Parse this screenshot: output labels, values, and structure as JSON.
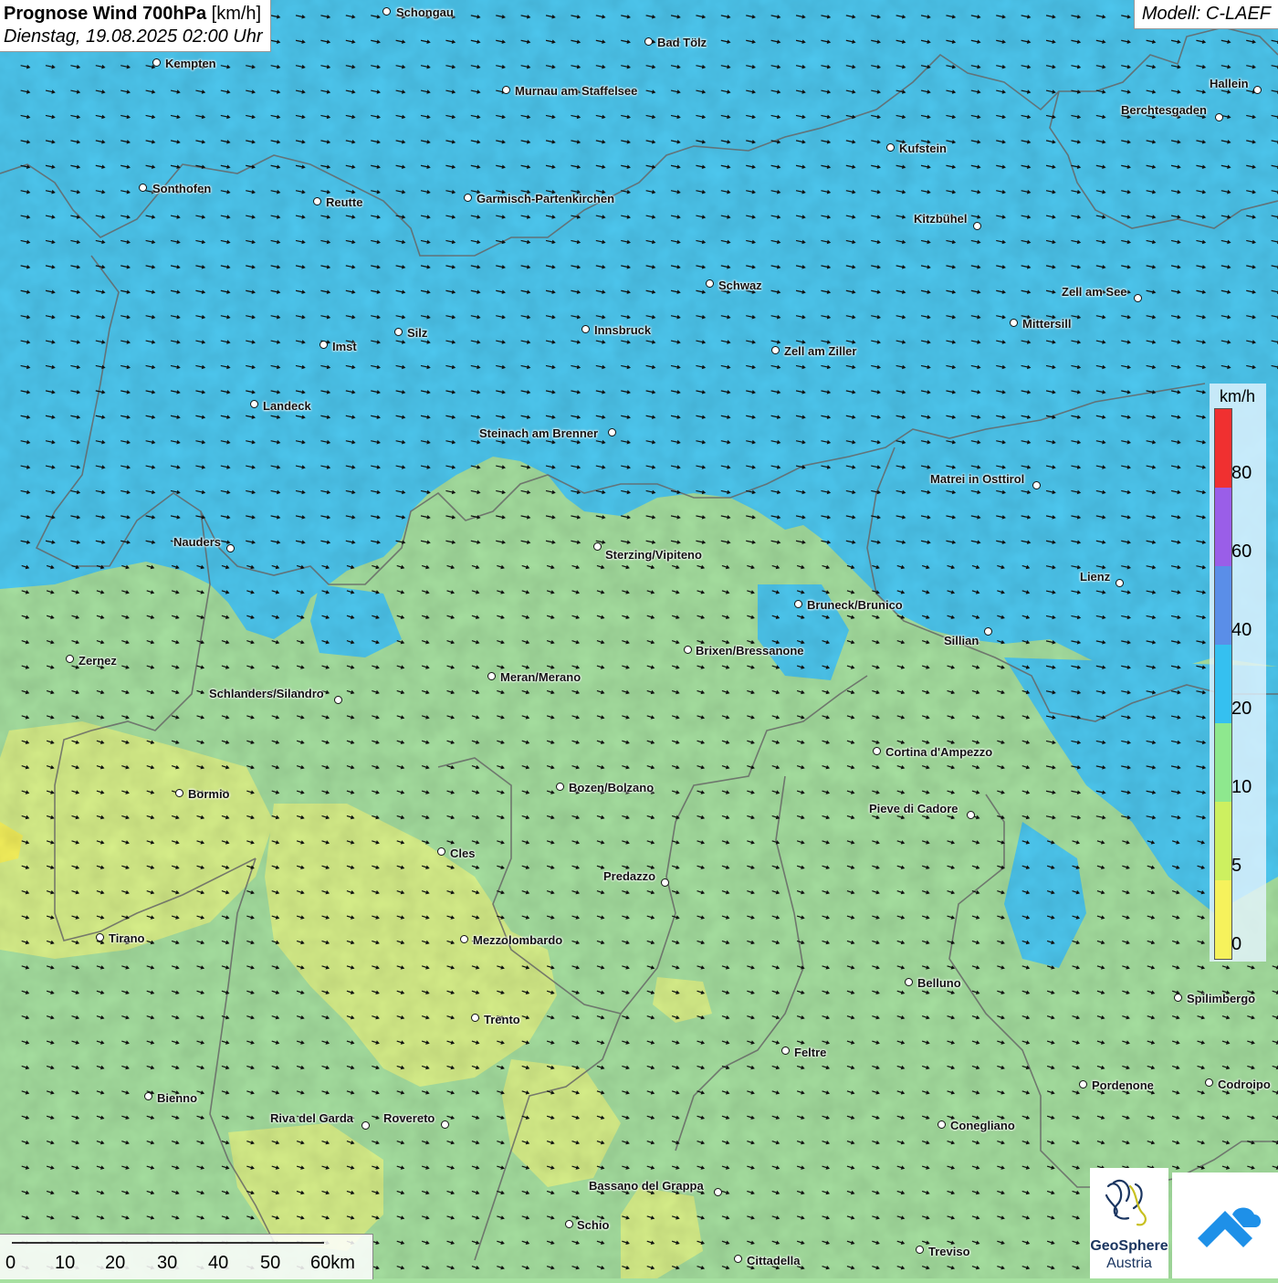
{
  "title": {
    "name": "Prognose Wind 700hPa",
    "unit": "[km/h]",
    "datetime": "Dienstag, 19.08.2025 02:00 Uhr"
  },
  "model": "Modell: C-LAEF",
  "legend": {
    "unit": "km/h",
    "ticks": [
      "80",
      "60",
      "40",
      "20",
      "10",
      "5",
      "0"
    ],
    "colors": [
      "#f03030",
      "#9a5ee8",
      "#5a8ee8",
      "#35c0f0",
      "#8ee88e",
      "#cdf060",
      "#f6f25c"
    ]
  },
  "scale_bar": {
    "ticks": [
      "0",
      "10",
      "20",
      "30",
      "40",
      "50",
      "60km"
    ]
  },
  "wind_field": {
    "direction": "east-southeast",
    "zone_colors": {
      "strong": "#4dc8f0",
      "moderate": "#a6e0a0",
      "weak": "#d8f08a"
    }
  },
  "cities": [
    {
      "name": "Schongau"
    },
    {
      "name": "Bad Tölz"
    },
    {
      "name": "Kempten"
    },
    {
      "name": "Murnau am Staffelsee"
    },
    {
      "name": "Hallein"
    },
    {
      "name": "Berchtesgaden"
    },
    {
      "name": "Kufstein"
    },
    {
      "name": "Sonthofen"
    },
    {
      "name": "Reutte"
    },
    {
      "name": "Garmisch-Partenkirchen"
    },
    {
      "name": "Kitzbühel"
    },
    {
      "name": "Schwaz"
    },
    {
      "name": "Zell am See"
    },
    {
      "name": "Mittersill"
    },
    {
      "name": "Innsbruck"
    },
    {
      "name": "Silz"
    },
    {
      "name": "Imst"
    },
    {
      "name": "Zell am Ziller"
    },
    {
      "name": "Landeck"
    },
    {
      "name": "Steinach am Brenner"
    },
    {
      "name": "Matrei in Osttirol"
    },
    {
      "name": "Nauders"
    },
    {
      "name": "Sterzing/Vipiteno"
    },
    {
      "name": "Lienz"
    },
    {
      "name": "Bruneck/Brunico"
    },
    {
      "name": "Sillian"
    },
    {
      "name": "Brixen/Bressanone"
    },
    {
      "name": "Zernez"
    },
    {
      "name": "Meran/Merano"
    },
    {
      "name": "Schlanders/Silandro"
    },
    {
      "name": "Cortina d'Ampezzo"
    },
    {
      "name": "Bozen/Bolzano"
    },
    {
      "name": "Bormio"
    },
    {
      "name": "Pieve di Cadore"
    },
    {
      "name": "Cles"
    },
    {
      "name": "Predazzo"
    },
    {
      "name": "Tirano"
    },
    {
      "name": "Mezzolombardo"
    },
    {
      "name": "Belluno"
    },
    {
      "name": "Spilimbergo"
    },
    {
      "name": "Trento"
    },
    {
      "name": "Feltre"
    },
    {
      "name": "Bienno"
    },
    {
      "name": "Pordenone"
    },
    {
      "name": "Codroipo"
    },
    {
      "name": "Riva del Garda"
    },
    {
      "name": "Rovereto"
    },
    {
      "name": "Conegliano"
    },
    {
      "name": "Bassano del Grappa"
    },
    {
      "name": "Schio"
    },
    {
      "name": "Treviso"
    },
    {
      "name": "Cittadella"
    }
  ],
  "logos": {
    "geosphere_name": "GeoSphere",
    "geosphere_sub": "Austria"
  }
}
